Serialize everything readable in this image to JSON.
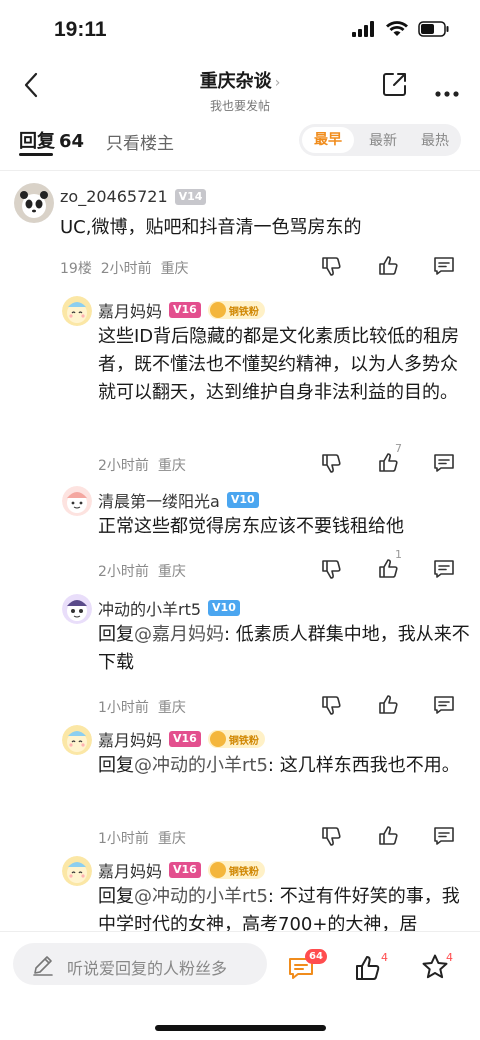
{
  "status": {
    "time": "19:11"
  },
  "nav": {
    "title": "重庆杂谈",
    "chevron": "›",
    "subtitle": "我也要发帖"
  },
  "tabs": {
    "reply_label": "回复",
    "reply_count": "64",
    "owner_only": "只看楼主"
  },
  "sort": {
    "options": [
      "最早",
      "最新",
      "最热"
    ],
    "selected": "最早"
  },
  "post": {
    "username": "zo_20465721",
    "level": "V14",
    "text": "UC,微博，贴吧和抖音清一色骂房东的",
    "floor": "19楼",
    "time": "2小时前",
    "location": "重庆"
  },
  "replies": [
    {
      "username": "嘉月妈妈",
      "level": "V16",
      "fan_badge": "铜铁粉",
      "text": "这些ID背后隐藏的都是文化素质比较低的租房者，既不懂法也不懂契约精神，以为人多势众就可以翻天，达到维护自身非法利益的目的。",
      "at": "",
      "time": "2小时前",
      "location": "重庆",
      "likes": "7"
    },
    {
      "username": "清晨第一缕阳光a",
      "level": "V10",
      "fan_badge": "",
      "text": "正常这些都觉得房东应该不要钱租给他",
      "at": "",
      "time": "2小时前",
      "location": "重庆",
      "likes": "1"
    },
    {
      "username": "冲动的小羊rt5",
      "level": "V10",
      "fan_badge": "",
      "reply_prefix": "回复",
      "at": "@嘉月妈妈",
      "text": ": 低素质人群集中地，我从来不下载",
      "time": "1小时前",
      "location": "重庆",
      "likes": ""
    },
    {
      "username": "嘉月妈妈",
      "level": "V16",
      "fan_badge": "铜铁粉",
      "reply_prefix": "回复",
      "at": "@冲动的小羊rt5",
      "text": ": 这几样东西我也不用。",
      "time": "1小时前",
      "location": "重庆",
      "likes": ""
    },
    {
      "username": "嘉月妈妈",
      "level": "V16",
      "fan_badge": "铜铁粉",
      "reply_prefix": "回复",
      "at": "@冲动的小羊rt5",
      "text": ": 不过有件好笑的事，我中学时代的女神，高考700+的大神，居",
      "time": "",
      "location": "",
      "likes": ""
    }
  ],
  "bottom": {
    "placeholder": "听说爱回复的人粉丝多",
    "comment_count": "64",
    "like_count": "4",
    "fav_count": "4"
  },
  "colors": {
    "accent": "#f08c1c",
    "badge_red": "#ff4d4f",
    "level_pink": "#e34f8e",
    "level_blue": "#4ba6f0"
  }
}
